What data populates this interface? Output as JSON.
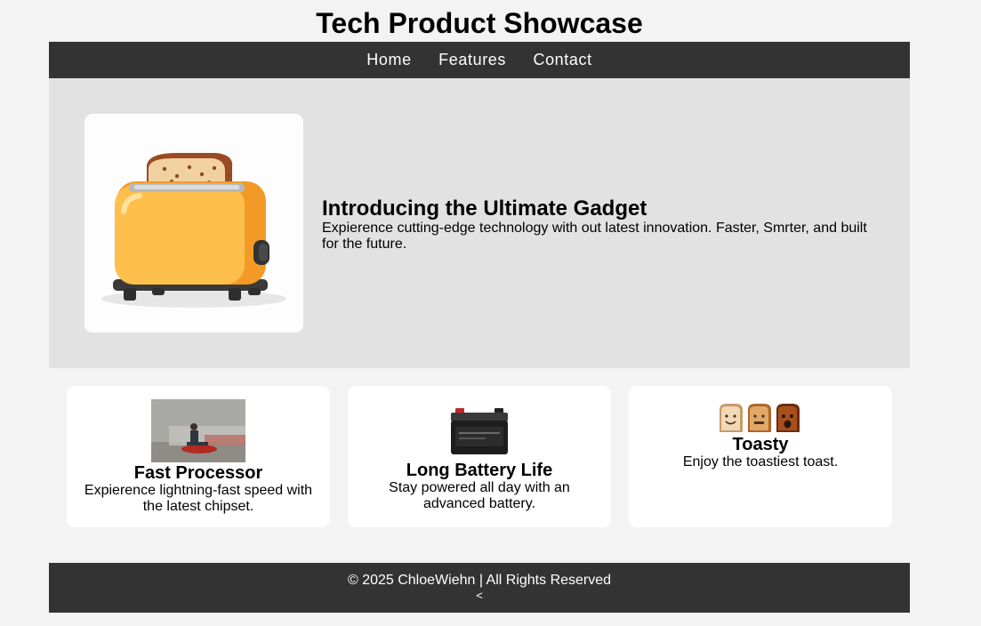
{
  "header": {
    "title": "Tech Product Showcase"
  },
  "nav": {
    "items": [
      "Home",
      "Features",
      "Contact"
    ]
  },
  "hero": {
    "image": "toaster-with-toast-illustration",
    "heading": "Introducing the Ultimate Gadget",
    "description": "Expierence cutting-edge technology with out latest innovation. Faster, Smrter, and built for the future."
  },
  "features": [
    {
      "image": "man-on-speeding-rocket-photo",
      "title": "Fast Processor",
      "description": "Expierence lightning-fast speed with the latest chipset."
    },
    {
      "image": "car-battery-photo",
      "title": "Long Battery Life",
      "description": "Stay powered all day with an advanced battery."
    },
    {
      "image": "three-toast-faces-photo",
      "title": "Toasty",
      "description": "Enjoy the toastiest toast."
    }
  ],
  "footer": {
    "text": "© 2025 ChloeWiehn | All Rights Reserved",
    "extra": "<"
  },
  "colors": {
    "background": "#f3f3f3",
    "nav": "#333333",
    "hero": "#e2e2e2",
    "card": "#ffffff"
  }
}
